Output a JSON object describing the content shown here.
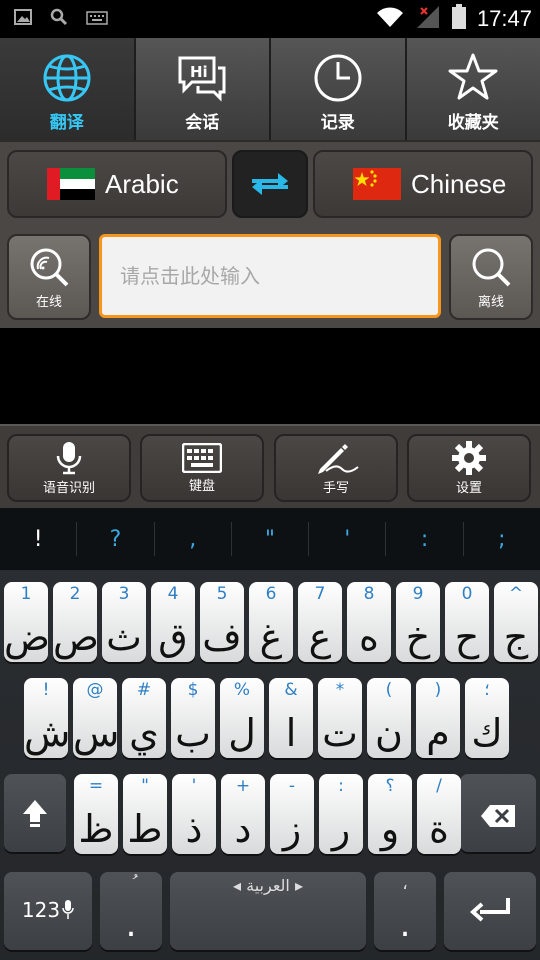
{
  "status_bar": {
    "time": "17:47"
  },
  "tabs": [
    {
      "label": "翻译",
      "icon": "globe-icon",
      "active": true
    },
    {
      "label": "会话",
      "icon": "chat-bubble-icon",
      "active": false
    },
    {
      "label": "记录",
      "icon": "clock-icon",
      "active": false
    },
    {
      "label": "收藏夹",
      "icon": "star-icon",
      "active": false
    }
  ],
  "languages": {
    "source": "Arabic",
    "target": "Chinese"
  },
  "search": {
    "online_label": "在线",
    "offline_label": "离线",
    "placeholder": "请点击此处输入",
    "value": ""
  },
  "toolbar": [
    {
      "label": "语音识别",
      "icon": "microphone-icon"
    },
    {
      "label": "键盘",
      "icon": "keyboard-icon"
    },
    {
      "label": "手写",
      "icon": "pen-icon"
    },
    {
      "label": "设置",
      "icon": "gear-icon"
    }
  ],
  "suggestions": [
    "!",
    "?",
    ",",
    "\"",
    "'",
    ":",
    ";"
  ],
  "keyboard": {
    "row1": [
      {
        "hint": "1",
        "main": "ض"
      },
      {
        "hint": "2",
        "main": "ص"
      },
      {
        "hint": "3",
        "main": "ث"
      },
      {
        "hint": "4",
        "main": "ق"
      },
      {
        "hint": "5",
        "main": "ف"
      },
      {
        "hint": "6",
        "main": "غ"
      },
      {
        "hint": "7",
        "main": "ع"
      },
      {
        "hint": "8",
        "main": "ه"
      },
      {
        "hint": "9",
        "main": "خ"
      },
      {
        "hint": "0",
        "main": "ح"
      },
      {
        "hint": "^",
        "main": "ج"
      }
    ],
    "row2": [
      {
        "hint": "!",
        "main": "ش"
      },
      {
        "hint": "@",
        "main": "س"
      },
      {
        "hint": "#",
        "main": "ي"
      },
      {
        "hint": "$",
        "main": "ب"
      },
      {
        "hint": "%",
        "main": "ل"
      },
      {
        "hint": "&",
        "main": "ا"
      },
      {
        "hint": "*",
        "main": "ت"
      },
      {
        "hint": "(",
        "main": "ن"
      },
      {
        "hint": ")",
        "main": "م"
      },
      {
        "hint": "؛",
        "main": "ك"
      }
    ],
    "row3": [
      {
        "hint": "=",
        "main": "ظ"
      },
      {
        "hint": "\"",
        "main": "ط"
      },
      {
        "hint": "'",
        "main": "ذ"
      },
      {
        "hint": "+",
        "main": "د"
      },
      {
        "hint": "-",
        "main": "ز"
      },
      {
        "hint": ":",
        "main": "ر"
      },
      {
        "hint": "؟",
        "main": "و"
      },
      {
        "hint": "/",
        "main": "ة"
      }
    ],
    "numbers_label": "123",
    "comma_hint": "ُ",
    "comma_main": ".",
    "space_label": "◂ العربية ▸",
    "period_hint": "،",
    "period_main": "."
  },
  "colors": {
    "accent": "#37c7f5",
    "input_border": "#f6961c",
    "swap_arrows": "#2ab8e8"
  }
}
